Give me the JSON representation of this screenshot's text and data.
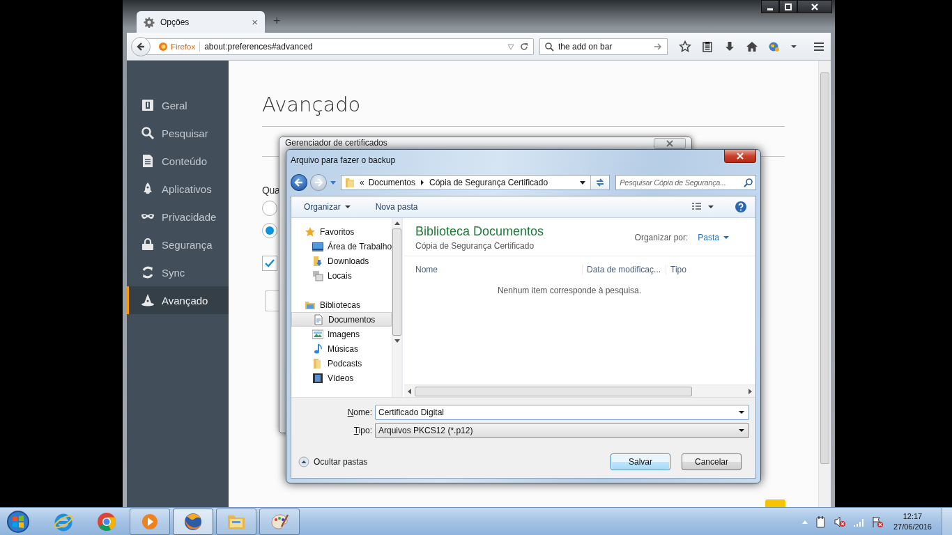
{
  "browser": {
    "tab": {
      "title": "Opções",
      "close": "×"
    },
    "new_tab": "+",
    "identity": "Firefox",
    "url": "about:preferences#advanced",
    "search": "the add on bar"
  },
  "sidebar": {
    "items": [
      {
        "label": "Geral",
        "selected": false
      },
      {
        "label": "Pesquisar",
        "selected": false
      },
      {
        "label": "Conteúdo",
        "selected": false
      },
      {
        "label": "Aplicativos",
        "selected": false
      },
      {
        "label": "Privacidade",
        "selected": false
      },
      {
        "label": "Segurança",
        "selected": false
      },
      {
        "label": "Sync",
        "selected": false
      },
      {
        "label": "Avançado",
        "selected": true
      }
    ]
  },
  "page": {
    "title": "Avançado",
    "question": "Qua",
    "radios": [
      {
        "selected": false
      },
      {
        "selected": true
      }
    ],
    "checkbox": {
      "checked": true
    }
  },
  "cert_manager": {
    "title": "Gerenciador de certificados"
  },
  "dialog": {
    "title": "Arquivo para fazer o backup",
    "overflow": "«",
    "breadcrumb": [
      "Documentos",
      "Cópia de Segurança Certificado"
    ],
    "search_placeholder": "Pesquisar Cópia de Segurança...",
    "toolbar": [
      "Organizar",
      "Nova pasta"
    ],
    "tree": [
      {
        "label": "Favoritos",
        "children": [
          {
            "label": "Área de Trabalho",
            "selected": false
          },
          {
            "label": "Downloads",
            "selected": false
          },
          {
            "label": "Locais",
            "selected": false
          }
        ]
      },
      {
        "label": "Bibliotecas",
        "children": [
          {
            "label": "Documentos",
            "selected": true
          },
          {
            "label": "Imagens",
            "selected": false
          },
          {
            "label": "Músicas",
            "selected": false
          },
          {
            "label": "Podcasts",
            "selected": false
          },
          {
            "label": "Vídeos",
            "selected": false
          }
        ]
      }
    ],
    "library_title": "Biblioteca Documentos",
    "library_subtitle": "Cópia de Segurança Certificado",
    "arrange_label": "Organizar por:",
    "arrange_value": "Pasta",
    "columns": [
      "Nome",
      "Data de modificaç...",
      "Tipo"
    ],
    "empty_message": "Nenhum item corresponde à pesquisa.",
    "name_label": "Nome:",
    "name_value": "Certificado Digital",
    "type_label": "Tipo:",
    "type_value": "Arquivos PKCS12 (*.p12)",
    "hide_folders": "Ocultar pastas",
    "buttons": [
      {
        "label": "Salvar",
        "default": true
      },
      {
        "label": "Cancelar",
        "default": false
      }
    ]
  },
  "taskbar": {
    "apps": [
      {
        "kind": "ie",
        "running": false,
        "selected": false
      },
      {
        "kind": "chrome",
        "running": false,
        "selected": false
      },
      {
        "kind": "media",
        "running": true,
        "selected": false
      },
      {
        "kind": "firefox",
        "running": true,
        "selected": true
      },
      {
        "kind": "explorer",
        "running": true,
        "selected": false
      },
      {
        "kind": "paint",
        "running": true,
        "selected": false
      }
    ],
    "time": "12:17",
    "date": "27/06/2016"
  }
}
